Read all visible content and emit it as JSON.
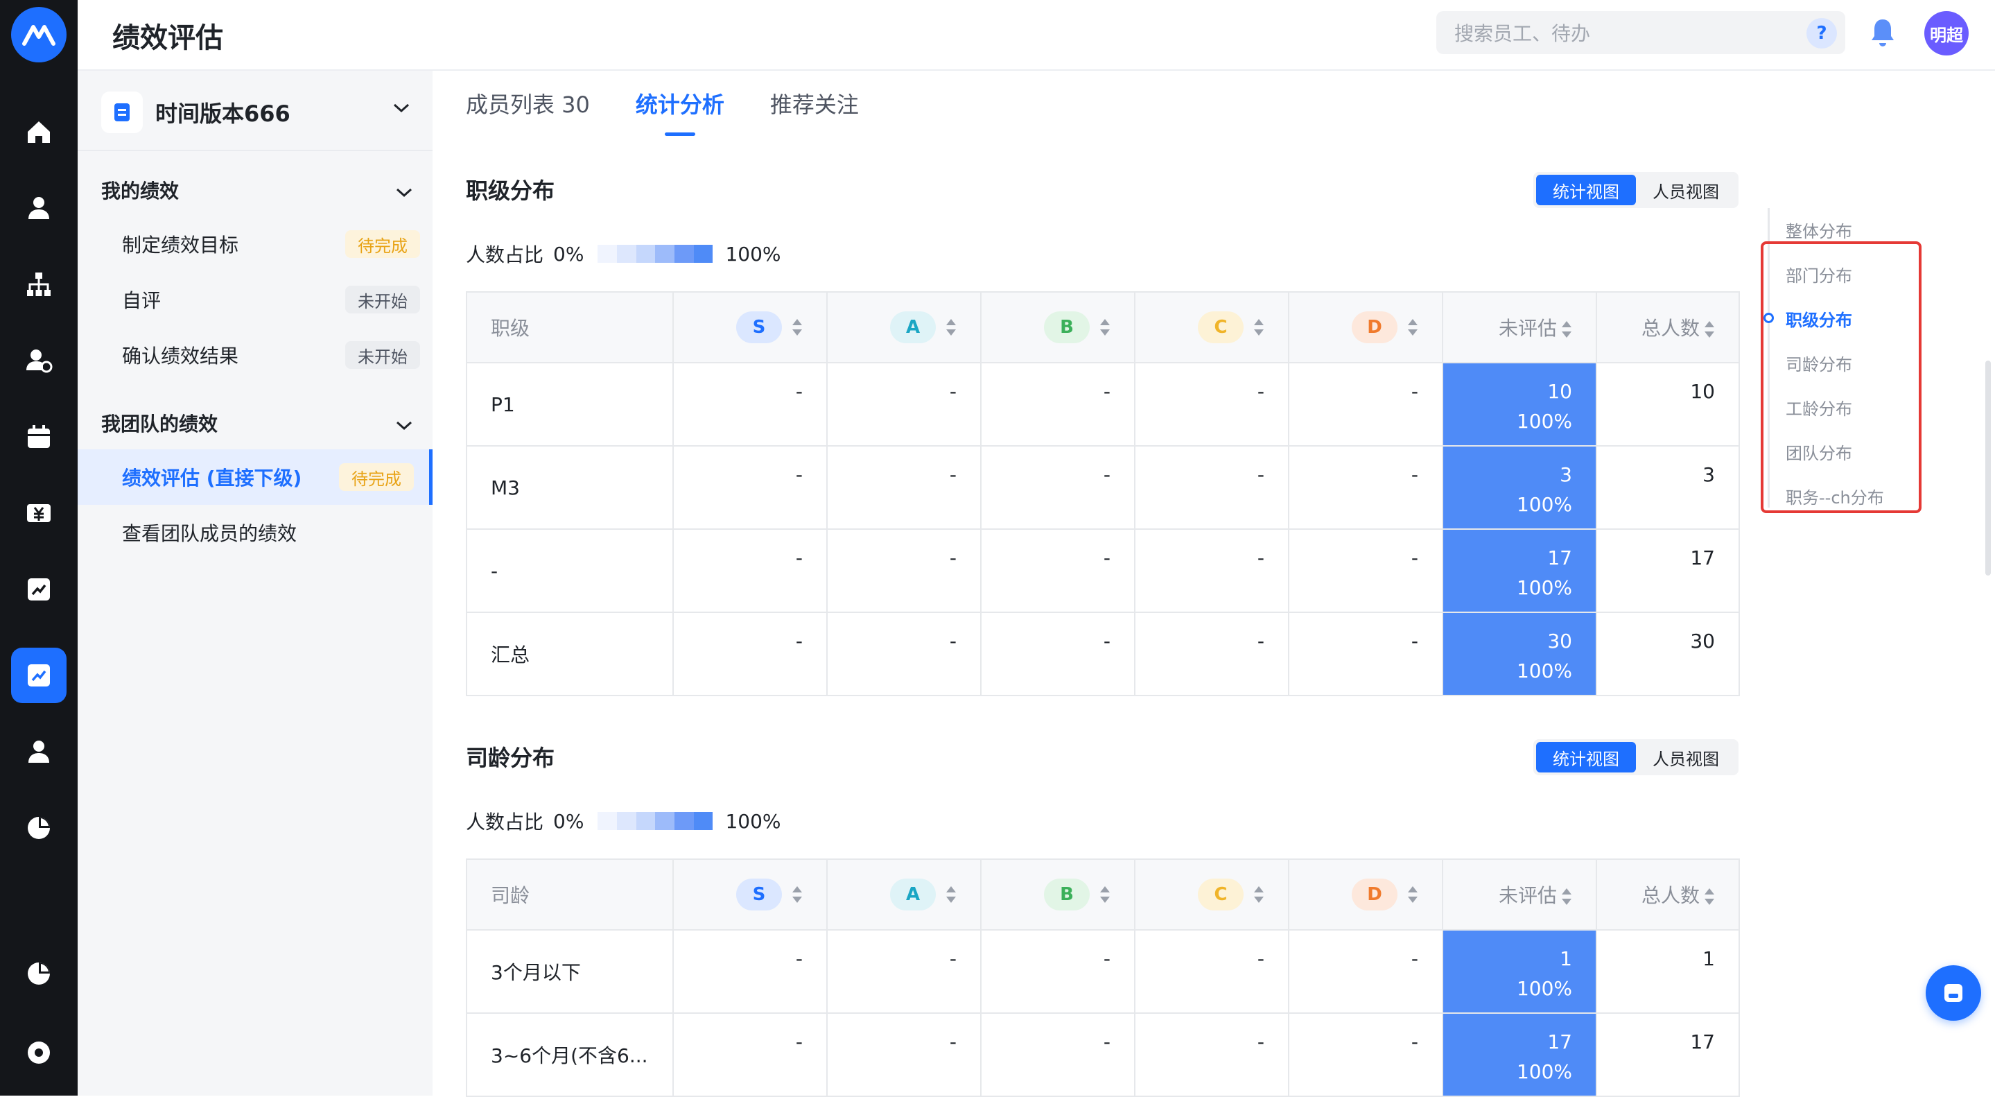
{
  "app": {
    "title": "绩效评估",
    "search_placeholder": "搜索员工、待办",
    "help_label": "?",
    "avatar_text": "明超"
  },
  "rail_icons": [
    "app-logo-icon",
    "home-icon",
    "person-icon",
    "org-chart-icon",
    "person-add-icon",
    "calendar-icon",
    "salary-icon",
    "chart-card-icon",
    "performance-icon",
    "person-icon",
    "pie-chart-icon",
    "pie-chart-icon",
    "settings-icon"
  ],
  "sidebar": {
    "version_label": "时间版本666",
    "groups": [
      {
        "label": "我的绩效",
        "items": [
          {
            "label": "制定绩效目标",
            "badge": "待完成",
            "badge_type": "pending"
          },
          {
            "label": "自评",
            "badge": "未开始",
            "badge_type": "notstart"
          },
          {
            "label": "确认绩效结果",
            "badge": "未开始",
            "badge_type": "notstart"
          }
        ]
      },
      {
        "label": "我团队的绩效",
        "items": [
          {
            "label": "绩效评估 (直接下级)",
            "badge": "待完成",
            "badge_type": "pending",
            "active": true
          },
          {
            "label": "查看团队成员的绩效",
            "badge": "",
            "badge_type": ""
          }
        ]
      }
    ]
  },
  "tabs": [
    {
      "label": "成员列表 30",
      "active": false
    },
    {
      "label": "统计分析",
      "active": true
    },
    {
      "label": "推荐关注",
      "active": false
    }
  ],
  "view_switch": {
    "stat": "统计视图",
    "person": "人员视图"
  },
  "legend": {
    "prefix": "人数占比",
    "min": "0%",
    "max": "100%"
  },
  "grade_colors": {
    "S": {
      "bg": "#dbe7ff",
      "fg": "#1e6fff"
    },
    "A": {
      "bg": "#dff3f7",
      "fg": "#1aa6c4"
    },
    "B": {
      "bg": "#e2f5e6",
      "fg": "#3bb05a"
    },
    "C": {
      "bg": "#fdf2d6",
      "fg": "#f0b429"
    },
    "D": {
      "bg": "#fde8dc",
      "fg": "#f07a2c"
    }
  },
  "sections": [
    {
      "title": "职级分布",
      "columns": [
        "职级",
        "S",
        "A",
        "B",
        "C",
        "D",
        "未评估",
        "总人数"
      ],
      "rows": [
        {
          "label": "P1",
          "cells": [
            "-",
            "-",
            "-",
            "-",
            "-"
          ],
          "unrated": "10",
          "unrated_pct": "100%",
          "total": "10"
        },
        {
          "label": "M3",
          "cells": [
            "-",
            "-",
            "-",
            "-",
            "-"
          ],
          "unrated": "3",
          "unrated_pct": "100%",
          "total": "3"
        },
        {
          "label": "-",
          "cells": [
            "-",
            "-",
            "-",
            "-",
            "-"
          ],
          "unrated": "17",
          "unrated_pct": "100%",
          "total": "17"
        },
        {
          "label": "汇总",
          "cells": [
            "-",
            "-",
            "-",
            "-",
            "-"
          ],
          "unrated": "30",
          "unrated_pct": "100%",
          "total": "30"
        }
      ]
    },
    {
      "title": "司龄分布",
      "columns": [
        "司龄",
        "S",
        "A",
        "B",
        "C",
        "D",
        "未评估",
        "总人数"
      ],
      "rows": [
        {
          "label": "3个月以下",
          "cells": [
            "-",
            "-",
            "-",
            "-",
            "-"
          ],
          "unrated": "1",
          "unrated_pct": "100%",
          "total": "1"
        },
        {
          "label": "3~6个月(不含6...",
          "cells": [
            "-",
            "-",
            "-",
            "-",
            "-"
          ],
          "unrated": "17",
          "unrated_pct": "100%",
          "total": "17"
        }
      ]
    }
  ],
  "anchor_nav": [
    {
      "label": "整体分布",
      "active": false
    },
    {
      "label": "部门分布",
      "active": false
    },
    {
      "label": "职级分布",
      "active": true
    },
    {
      "label": "司龄分布",
      "active": false
    },
    {
      "label": "工龄分布",
      "active": false
    },
    {
      "label": "团队分布",
      "active": false
    },
    {
      "label": "职务--ch分布",
      "active": false
    }
  ]
}
